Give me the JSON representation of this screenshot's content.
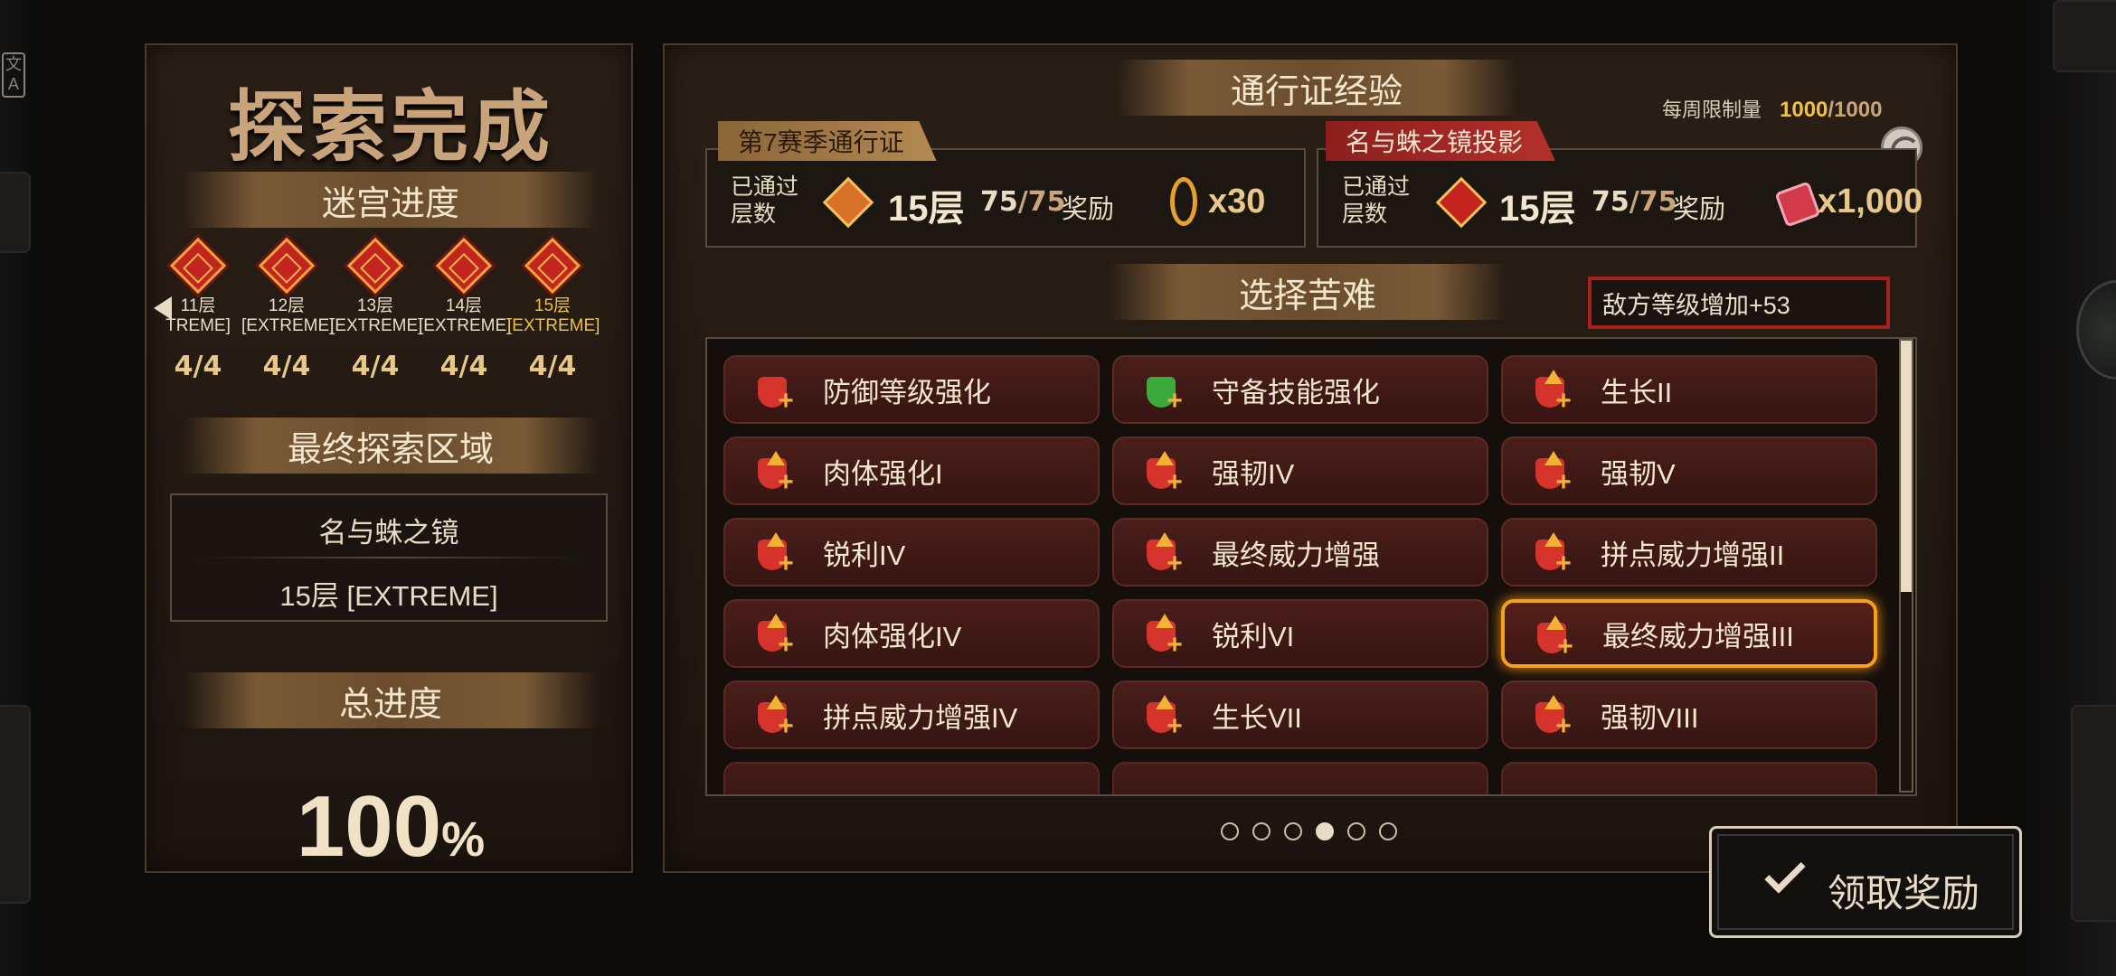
{
  "left": {
    "title": "探索完成",
    "progress_banner": "迷宫进度",
    "floors": [
      {
        "label": "11层",
        "diff": "TREME]",
        "count": "4/4"
      },
      {
        "label": "12层",
        "diff": "[EXTREME]",
        "count": "4/4"
      },
      {
        "label": "13层",
        "diff": "[EXTREME]",
        "count": "4/4"
      },
      {
        "label": "14层",
        "diff": "[EXTREME]",
        "count": "4/4"
      },
      {
        "label": "15层",
        "diff": "[EXTREME]",
        "count": "4/4",
        "current": true
      }
    ],
    "final_area_banner": "最终探索区域",
    "final_area_name": "名与蛛之镜",
    "final_area_floor": "15层 [EXTREME]",
    "total_banner": "总进度",
    "total_value": "100",
    "total_unit": "%"
  },
  "right": {
    "exp_banner": "通行证经验",
    "weekly_label": "每周限制量",
    "weekly_value": "1000",
    "weekly_max": "/1000",
    "season_pass": {
      "tag": "第7赛季通行证",
      "passed_label_1": "已通过",
      "passed_label_2": "层数",
      "floors": "15层",
      "ratio_value": "75",
      "ratio_max": "/75",
      "reward_label": "奖励",
      "reward_amount": "x30",
      "reward_icon": "lunacy-icon"
    },
    "mirror_pass": {
      "tag": "名与蛛之镜投影",
      "passed_label_1": "已通过",
      "passed_label_2": "层数",
      "floors": "15层",
      "ratio_value": "75",
      "ratio_max": "/75",
      "reward_label": "奖励",
      "reward_amount": "x1,000",
      "reward_icon": "ticket-icon"
    },
    "hardship_banner": "选择苦难",
    "penalty_text": "敌方等级增加+53",
    "difficulties": [
      {
        "label": "防御等级强化",
        "icon": "shield-red"
      },
      {
        "label": "守备技能强化",
        "icon": "shield-green"
      },
      {
        "label": "生长II",
        "icon": "growth"
      },
      {
        "label": "肉体强化I",
        "icon": "body"
      },
      {
        "label": "强韧IV",
        "icon": "tough"
      },
      {
        "label": "强韧V",
        "icon": "tough"
      },
      {
        "label": "锐利IV",
        "icon": "sharp"
      },
      {
        "label": "最终威力增强",
        "icon": "power"
      },
      {
        "label": "拼点威力增强II",
        "icon": "clash"
      },
      {
        "label": "肉体强化IV",
        "icon": "body"
      },
      {
        "label": "锐利VI",
        "icon": "sharp"
      },
      {
        "label": "最终威力增强III",
        "icon": "power",
        "selected": true
      },
      {
        "label": "拼点威力增强IV",
        "icon": "clash"
      },
      {
        "label": "生长VII",
        "icon": "growth"
      },
      {
        "label": "强韧VIII",
        "icon": "tough"
      }
    ],
    "pages": 6,
    "active_page": 4,
    "claim_label": "领取奖励"
  },
  "colors": {
    "accent_gold": "#f0c040",
    "selected_border": "#f4a21e",
    "penalty_border": "#a8201c",
    "danger_red": "#c4241f"
  }
}
